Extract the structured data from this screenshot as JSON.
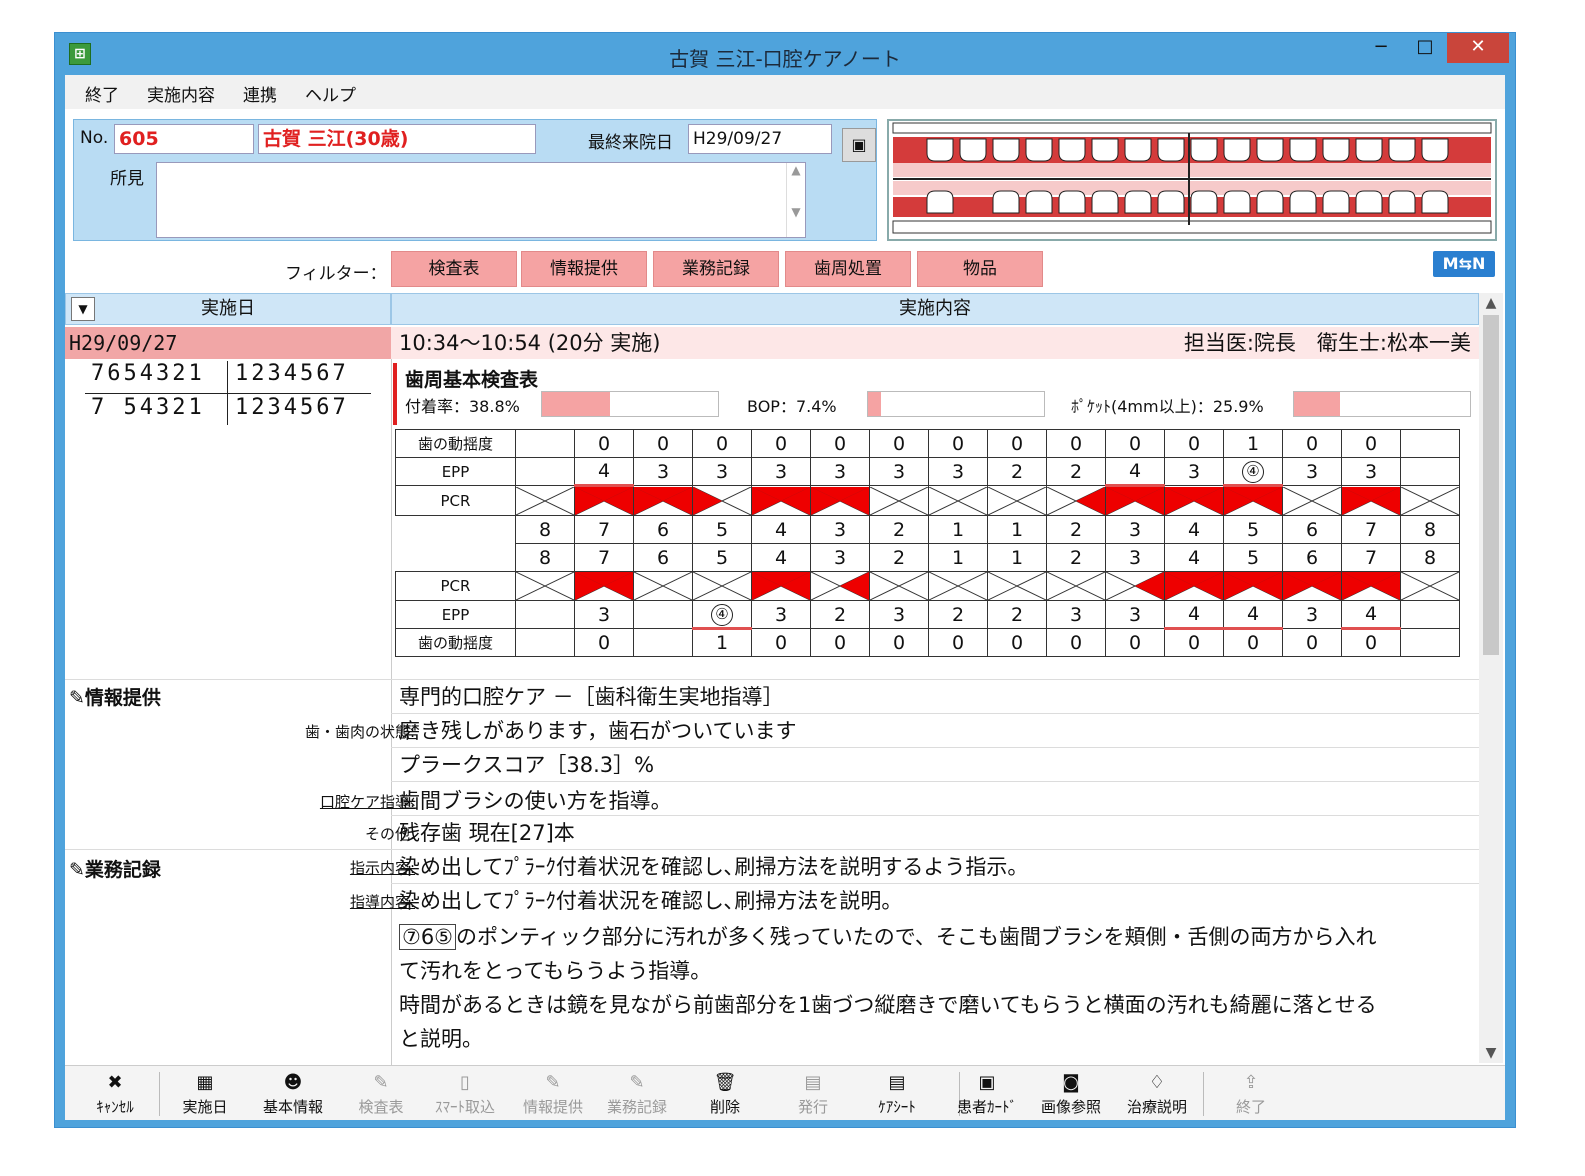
{
  "window": {
    "title": "古賀 三江-口腔ケアノート",
    "minimize": "−",
    "maximize": "□",
    "close": "✕"
  },
  "menu": [
    "終了",
    "実施内容",
    "連携",
    "ヘルプ"
  ],
  "patient": {
    "no_label": "No.",
    "no": "605",
    "name": "古賀 三江(30歳)",
    "last_visit_label": "最終来院日",
    "last_visit": "H29/09/27",
    "findings_label": "所見",
    "findings": ""
  },
  "filter": {
    "label": "フィルター：",
    "buttons": [
      "検査表",
      "情報提供",
      "業務記録",
      "歯周処置",
      "物品"
    ],
    "msn": "M⇆N"
  },
  "table_header": {
    "sort": "▼",
    "date": "実施日",
    "content": "実施内容"
  },
  "record": {
    "date": "H29/09/27",
    "time": "10:34～10:54 (20分 実施)",
    "staff": "担当医:院長　衛生士:松本一美",
    "tooth_upper_left": "7654321",
    "tooth_upper_right": "1234567",
    "tooth_lower_left": "7 54321",
    "tooth_lower_right": "1234567"
  },
  "perio": {
    "title": "歯周基本検査表",
    "attach_label": "付着率：38.8%",
    "attach_value": 38.8,
    "bop_label": "BOP：7.4%",
    "bop_value": 7.4,
    "pocket_label": "ﾎﾟｹｯﾄ(4mm以上)：25.9%",
    "pocket_value": 25.9,
    "row_labels": {
      "mobility": "歯の動揺度",
      "epp": "EPP",
      "pcr": "PCR"
    },
    "upper_mobility": [
      "",
      "0",
      "0",
      "0",
      "0",
      "0",
      "0",
      "0",
      "0",
      "0",
      "0",
      "0",
      "1",
      "0",
      "0",
      ""
    ],
    "upper_epp": [
      "",
      "4",
      "3",
      "3",
      "3",
      "3",
      "3",
      "3",
      "2",
      "2",
      "4",
      "3",
      "④",
      "3",
      "3",
      ""
    ],
    "upper_teeth": [
      "8",
      "7",
      "6",
      "5",
      "4",
      "3",
      "2",
      "1",
      "1",
      "2",
      "3",
      "4",
      "5",
      "6",
      "7",
      "8"
    ],
    "lower_teeth": [
      "8",
      "7",
      "6",
      "5",
      "4",
      "3",
      "2",
      "1",
      "1",
      "2",
      "3",
      "4",
      "5",
      "6",
      "7",
      "8"
    ],
    "lower_epp": [
      "",
      "3",
      "",
      "④",
      "3",
      "2",
      "3",
      "2",
      "2",
      "3",
      "3",
      "4",
      "4",
      "3",
      "4",
      ""
    ],
    "lower_mobility": [
      "",
      "0",
      "",
      "1",
      "0",
      "0",
      "0",
      "0",
      "0",
      "0",
      "0",
      "0",
      "0",
      "0",
      "0",
      ""
    ]
  },
  "info_section": {
    "title": "情報提供",
    "heading": "専門的口腔ケア －［歯科衛生実地指導］",
    "rows": [
      {
        "label": "歯・歯肉の状態:",
        "value": "磨き残しがあります，歯石がついています"
      },
      {
        "label": "",
        "value": "プラークスコア［38.3］%"
      },
      {
        "label": "口腔ケア指導:",
        "value": "歯間ブラシの使い方を指導。"
      },
      {
        "label": "その他:",
        "value": "残存歯 現在[27]本"
      }
    ]
  },
  "business_section": {
    "title": "業務記録",
    "rows": [
      {
        "label": "指示内容:",
        "value": "染め出してﾌﾟﾗｰｸ付着状況を確認し､刷掃方法を説明するよう指示。"
      },
      {
        "label": "指導内容:",
        "value": "染め出してﾌﾟﾗｰｸ付着状況を確認し､刷掃方法を説明。"
      }
    ],
    "note_badge": "⑦6⑤",
    "note_lines": [
      "のポンティック部分に汚れが多く残っていたので、そこも歯間ブラシを頬側・舌側の両方から入れ",
      "て汚れをとってもらうよう指導。",
      "時間があるときは鏡を見ながら前歯部分を1歯づつ縦磨きで磨いてもらうと横面の汚れも綺麗に落とせる",
      "と説明。"
    ]
  },
  "toolbar": [
    {
      "label": "ｷｬﾝｾﾙ",
      "icon": "cancel-icon",
      "glyph": "✖",
      "enabled": true
    },
    {
      "label": "実施日",
      "icon": "calendar-icon",
      "glyph": "▦",
      "enabled": true
    },
    {
      "label": "基本情報",
      "icon": "people-icon",
      "glyph": "☻",
      "enabled": true
    },
    {
      "label": "検査表",
      "icon": "pen-icon",
      "glyph": "✎",
      "enabled": false
    },
    {
      "label": "ｽﾏｰﾄ取込",
      "icon": "import-icon",
      "glyph": "▯",
      "enabled": false
    },
    {
      "label": "情報提供",
      "icon": "pen-icon",
      "glyph": "✎",
      "enabled": false
    },
    {
      "label": "業務記録",
      "icon": "pen-icon",
      "glyph": "✎",
      "enabled": false
    },
    {
      "label": "削除",
      "icon": "trash-icon",
      "glyph": "🗑",
      "enabled": true
    },
    {
      "label": "発行",
      "icon": "document-icon",
      "glyph": "▤",
      "enabled": false
    },
    {
      "label": "ｹｱｼｰﾄ",
      "icon": "document-icon",
      "glyph": "▤",
      "enabled": true
    },
    {
      "label": "患者ｶｰﾄﾞ",
      "icon": "card-icon",
      "glyph": "▣",
      "enabled": true
    },
    {
      "label": "画像参照",
      "icon": "camera-icon",
      "glyph": "◙",
      "enabled": true
    },
    {
      "label": "治療説明",
      "icon": "tooth-icon",
      "glyph": "♢",
      "enabled": true
    },
    {
      "label": "終了",
      "icon": "exit-icon",
      "glyph": "⇪",
      "enabled": false
    }
  ]
}
